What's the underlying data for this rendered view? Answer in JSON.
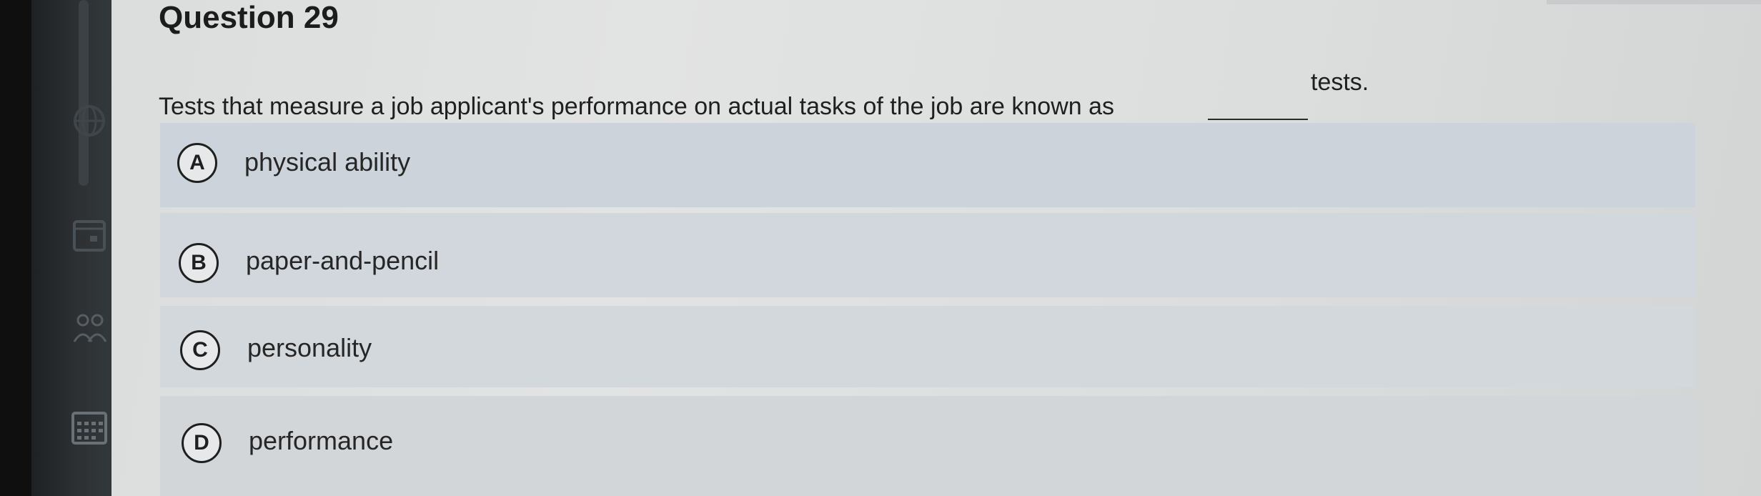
{
  "question": {
    "title": "Question 29",
    "prompt_main": "Tests that measure a job applicant's performance on actual tasks of the job are known as",
    "prompt_end": "tests."
  },
  "options": [
    {
      "letter": "A",
      "text": "physical ability"
    },
    {
      "letter": "B",
      "text": "paper-and-pencil"
    },
    {
      "letter": "C",
      "text": "personality"
    },
    {
      "letter": "D",
      "text": "performance"
    }
  ],
  "sidebar": {
    "icons": [
      "globe-icon",
      "calendar-icon",
      "people-icon",
      "grid-calendar-icon"
    ]
  }
}
